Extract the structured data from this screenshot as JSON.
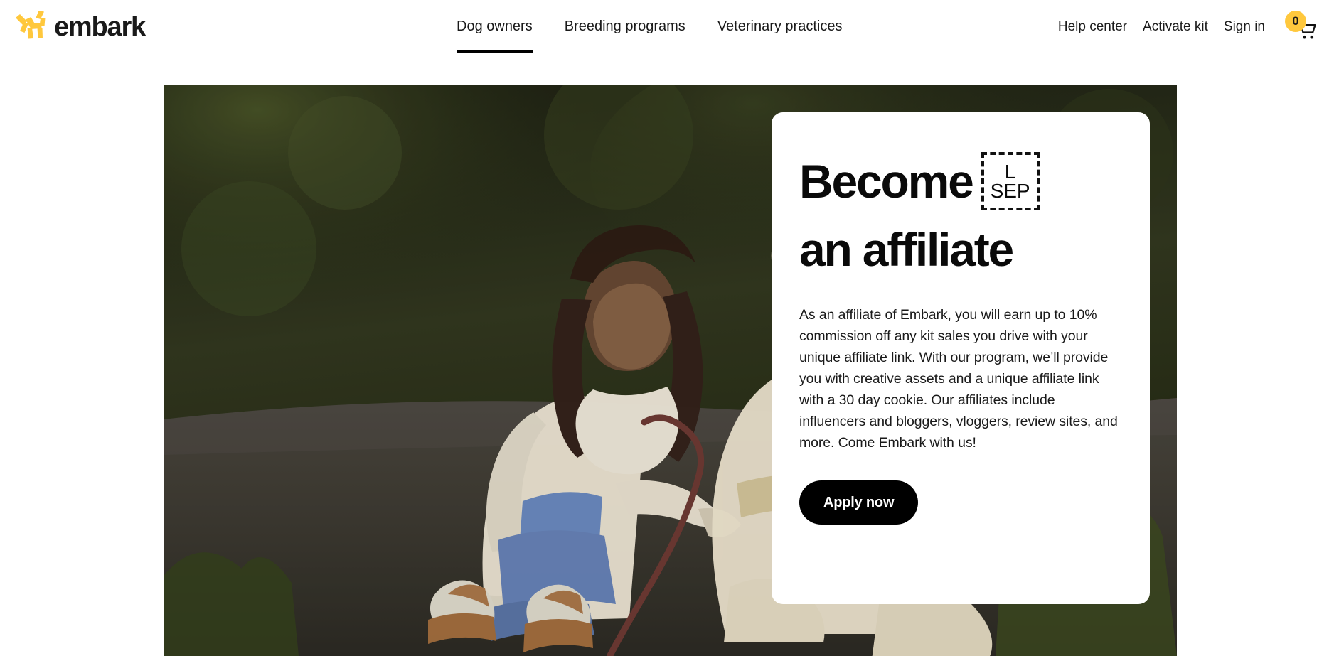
{
  "brand": {
    "name": "embark",
    "logo_icon": "embark-dog-mark",
    "logo_color": "#FFC83D"
  },
  "header": {
    "nav": [
      {
        "label": "Dog owners",
        "active": true
      },
      {
        "label": "Breeding programs",
        "active": false
      },
      {
        "label": "Veterinary practices",
        "active": false
      }
    ],
    "utility": [
      {
        "label": "Help center"
      },
      {
        "label": "Activate kit"
      },
      {
        "label": "Sign in"
      }
    ],
    "cart": {
      "icon": "shopping-cart-icon",
      "count": "0",
      "badge_color": "#FFC83D"
    },
    "active_underline_color": "#000000",
    "border_color": "#D8D8D8"
  },
  "hero": {
    "photo_alt": "Woman kneeling on a paved road beside a light-colored dog on a leash, green foliage behind them",
    "card": {
      "title_part1": "Become",
      "title_missing_glyph": {
        "line1": "L",
        "line2": "SEP"
      },
      "title_part2": "an affiliate",
      "body": "As an affiliate of Embark, you will earn up to 10% commission off any kit sales you drive with your unique affiliate link. With our program, we’ll provide you with creative assets and a unique affiliate link with a 30 day cookie. Our affiliates include influencers and bloggers, vloggers, review sites, and more. Come Embark with us!",
      "cta_label": "Apply now",
      "cta_bg": "#000000",
      "cta_text_color": "#FFFFFF",
      "card_bg": "#FFFFFF"
    }
  }
}
